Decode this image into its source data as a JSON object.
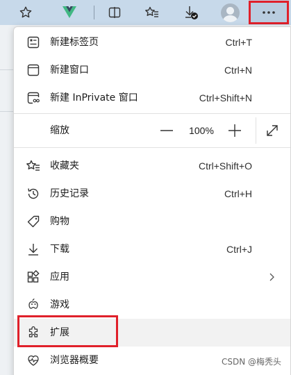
{
  "toolbar": {
    "icons": [
      "star-outline-icon",
      "vue-devtools-icon",
      "split-screen-icon",
      "favorites-icon",
      "downloads-icon",
      "profile-avatar-icon",
      "more-options-icon"
    ]
  },
  "menu": {
    "new_tab": {
      "label": "新建标签页",
      "shortcut": "Ctrl+T"
    },
    "new_window": {
      "label": "新建窗口",
      "shortcut": "Ctrl+N"
    },
    "new_inprivate": {
      "label": "新建 InPrivate 窗口",
      "shortcut": "Ctrl+Shift+N"
    },
    "zoom": {
      "label": "缩放",
      "value": "100%",
      "minus": "—",
      "plus": "+"
    },
    "favorites": {
      "label": "收藏夹",
      "shortcut": "Ctrl+Shift+O"
    },
    "history": {
      "label": "历史记录",
      "shortcut": "Ctrl+H"
    },
    "shopping": {
      "label": "购物"
    },
    "downloads": {
      "label": "下载",
      "shortcut": "Ctrl+J"
    },
    "apps": {
      "label": "应用"
    },
    "games": {
      "label": "游戏"
    },
    "extensions": {
      "label": "扩展"
    },
    "essentials": {
      "label": "浏览器概要"
    }
  },
  "watermark": "CSDN @梅秃头",
  "colors": {
    "highlight_border": "#e0202a",
    "toolbar_bg": "#c7d9ea",
    "vue_green": "#41b883",
    "vue_dark": "#35495e"
  }
}
